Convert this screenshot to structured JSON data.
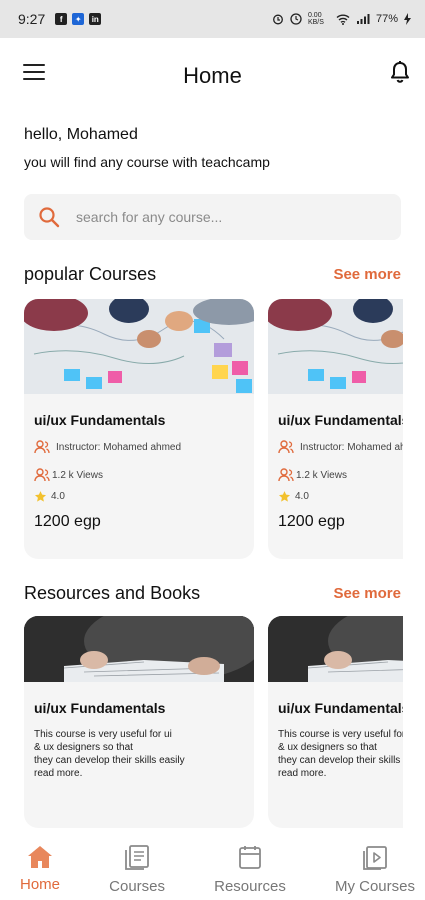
{
  "status_bar": {
    "time": "9:27",
    "battery": "77%",
    "data_speed": "0.00 KB/S"
  },
  "header": {
    "title": "Home"
  },
  "greeting": {
    "hello": "hello, Mohamed",
    "subtitle": "you will find any course with teachcamp"
  },
  "search": {
    "placeholder": "search for any course..."
  },
  "popular_courses": {
    "title": "popular Courses",
    "see_more": "See more",
    "cards": [
      {
        "title": "ui/ux Fundamentals",
        "instructor": "Instructor: Mohamed ahmed",
        "views": "1.2 k Views",
        "rating": "4.0",
        "price": "1200 egp"
      },
      {
        "title": "ui/ux Fundamentals",
        "instructor": "Instructor: Mohamed ahmed",
        "views": "1.2 k Views",
        "rating": "4.0",
        "price": "1200 egp"
      }
    ]
  },
  "resources": {
    "title": "Resources and Books",
    "see_more": "See more",
    "cards": [
      {
        "title": "ui/ux Fundamentals",
        "description": "This course is very useful for ui\n& ux designers so that\n they can develop their skills easily\nread more."
      },
      {
        "title": "ui/ux Fundamentals",
        "description": "This course is very useful for ui\n& ux designers so that\n they can develop their skills easily\nread more."
      }
    ]
  },
  "bottom_nav": {
    "items": [
      {
        "label": "Home",
        "icon": "home-icon",
        "active": true
      },
      {
        "label": "Courses",
        "icon": "courses-icon",
        "active": false
      },
      {
        "label": "Resources",
        "icon": "resources-icon",
        "active": false
      },
      {
        "label": "My Courses",
        "icon": "my-courses-icon",
        "active": false
      }
    ]
  },
  "colors": {
    "accent": "#e06a3c",
    "card_bg": "#f5f5f5",
    "search_bg": "#f3f3f3",
    "star": "#f2c12e"
  }
}
